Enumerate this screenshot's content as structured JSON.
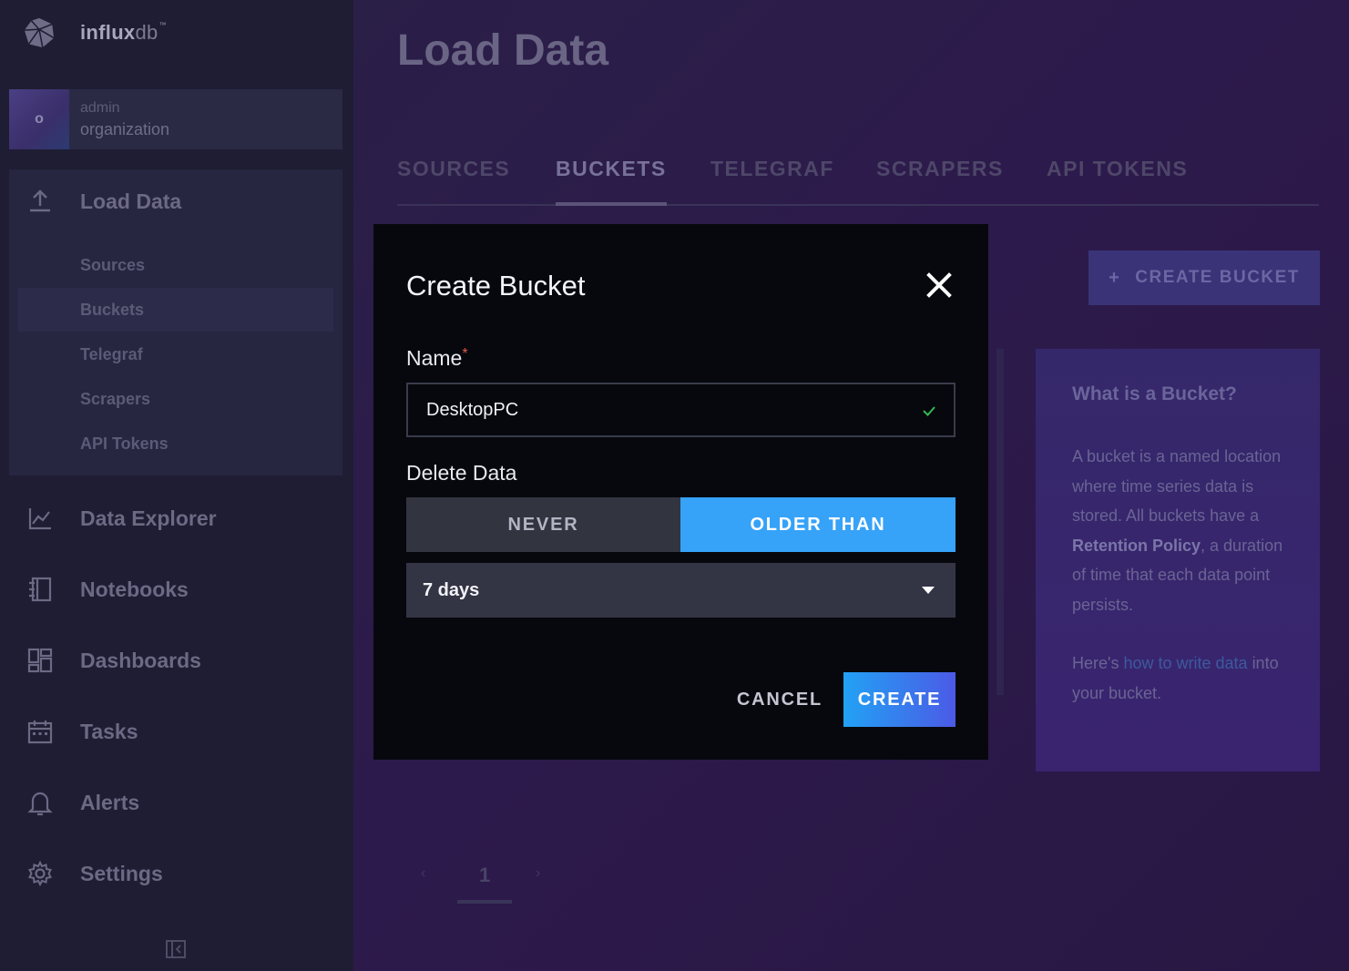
{
  "brand": {
    "name_bold": "influx",
    "name_light": "db",
    "trademark": "™"
  },
  "org": {
    "avatar_letter": "o",
    "user": "admin",
    "name": "organization"
  },
  "sidebar": {
    "load_data": {
      "label": "Load Data",
      "icon": "upload-icon",
      "sub_items": [
        {
          "label": "Sources",
          "active": false
        },
        {
          "label": "Buckets",
          "active": true
        },
        {
          "label": "Telegraf",
          "active": false
        },
        {
          "label": "Scrapers",
          "active": false
        },
        {
          "label": "API Tokens",
          "active": false
        }
      ]
    },
    "items": [
      {
        "label": "Data Explorer",
        "icon": "graph-icon"
      },
      {
        "label": "Notebooks",
        "icon": "notebook-icon"
      },
      {
        "label": "Dashboards",
        "icon": "dashboard-icon"
      },
      {
        "label": "Tasks",
        "icon": "calendar-icon"
      },
      {
        "label": "Alerts",
        "icon": "bell-icon"
      },
      {
        "label": "Settings",
        "icon": "gear-icon"
      }
    ],
    "collapse_icon": "collapse-sidebar-icon"
  },
  "main": {
    "title": "Load Data",
    "tabs": [
      {
        "label": "SOURCES",
        "active": false
      },
      {
        "label": "BUCKETS",
        "active": true
      },
      {
        "label": "TELEGRAF",
        "active": false
      },
      {
        "label": "SCRAPERS",
        "active": false
      },
      {
        "label": "API TOKENS",
        "active": false
      }
    ],
    "create_bucket_label": "CREATE BUCKET",
    "create_bucket_plus": "+",
    "info": {
      "title": "What is a Bucket?",
      "body_1": "A bucket is a named location where time series data is stored. All buckets have a",
      "body_bold": "Retention Policy",
      "body_2": ", a duration of time that each data point persists.",
      "footer_pre": "Here's",
      "footer_link": "how to write data",
      "footer_post": "into your bucket."
    },
    "pager": {
      "prev": "‹",
      "page": "1",
      "next": "›"
    }
  },
  "modal": {
    "title": "Create Bucket",
    "close_icon": "close-icon",
    "name_label": "Name",
    "required_mark": "*",
    "name_value": "DesktopPC",
    "delete_label": "Delete Data",
    "toggle_never": "NEVER",
    "toggle_older": "OLDER THAN",
    "selected_toggle": "OLDER THAN",
    "retention_value": "7 days",
    "cancel_label": "CANCEL",
    "create_label": "CREATE"
  },
  "colors": {
    "accent_blue": "#36a2f8",
    "create_gradient_start": "#22a2f5",
    "create_gradient_end": "#4b5ae6",
    "valid_check": "#34bb55",
    "required_mark": "#e85b4c"
  }
}
